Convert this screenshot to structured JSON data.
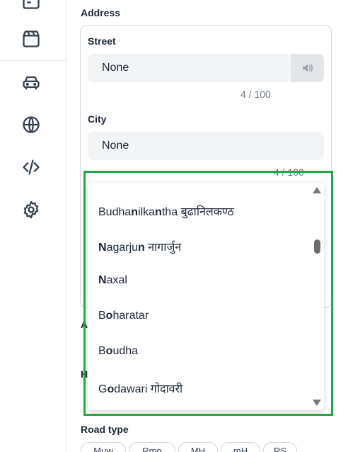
{
  "sidebar": {
    "icons": [
      "calendar-icon",
      "clapperboard-icon",
      "car-icon",
      "globe-icon",
      "code-icon",
      "settings-icon"
    ]
  },
  "address": {
    "section_label": "Address",
    "street": {
      "label": "Street",
      "value": "None",
      "counter": "4 / 100"
    },
    "city": {
      "label": "City",
      "value": "None",
      "counter": "4 / 100"
    }
  },
  "dropdown": {
    "options": [
      {
        "bold": "",
        "rest": "Budhanilkantha बुढानिलकण्ठ",
        "parts": [
          [
            "B",
            0
          ],
          [
            "udha",
            0
          ],
          [
            "n",
            1
          ],
          [
            "ilka",
            0
          ],
          [
            "n",
            1
          ],
          [
            "tha बुढानिलकण्ठ",
            0
          ]
        ]
      },
      {
        "parts": [
          [
            "N",
            1
          ],
          [
            "agarju",
            0
          ],
          [
            "n",
            1
          ],
          [
            " नागार्जुन",
            0
          ]
        ]
      },
      {
        "parts": [
          [
            "N",
            1
          ],
          [
            "axal",
            0
          ]
        ]
      },
      {
        "parts": [
          [
            "B",
            0
          ],
          [
            "o",
            1
          ],
          [
            "haratar",
            0
          ]
        ]
      },
      {
        "parts": [
          [
            "B",
            0
          ],
          [
            "o",
            1
          ],
          [
            "udha",
            0
          ]
        ]
      },
      {
        "parts": [
          [
            "G",
            0
          ],
          [
            "o",
            1
          ],
          [
            "dawari गोदावरी",
            0
          ]
        ]
      }
    ]
  },
  "partial_labels": {
    "a": "A",
    "h": "H"
  },
  "road_type": {
    "label": "Road type",
    "chips": [
      "Muw",
      "Rmp",
      "MH",
      "mH",
      "RS"
    ]
  },
  "colors": {
    "highlight": "#22a845",
    "input_bg": "#f2f3f5"
  }
}
